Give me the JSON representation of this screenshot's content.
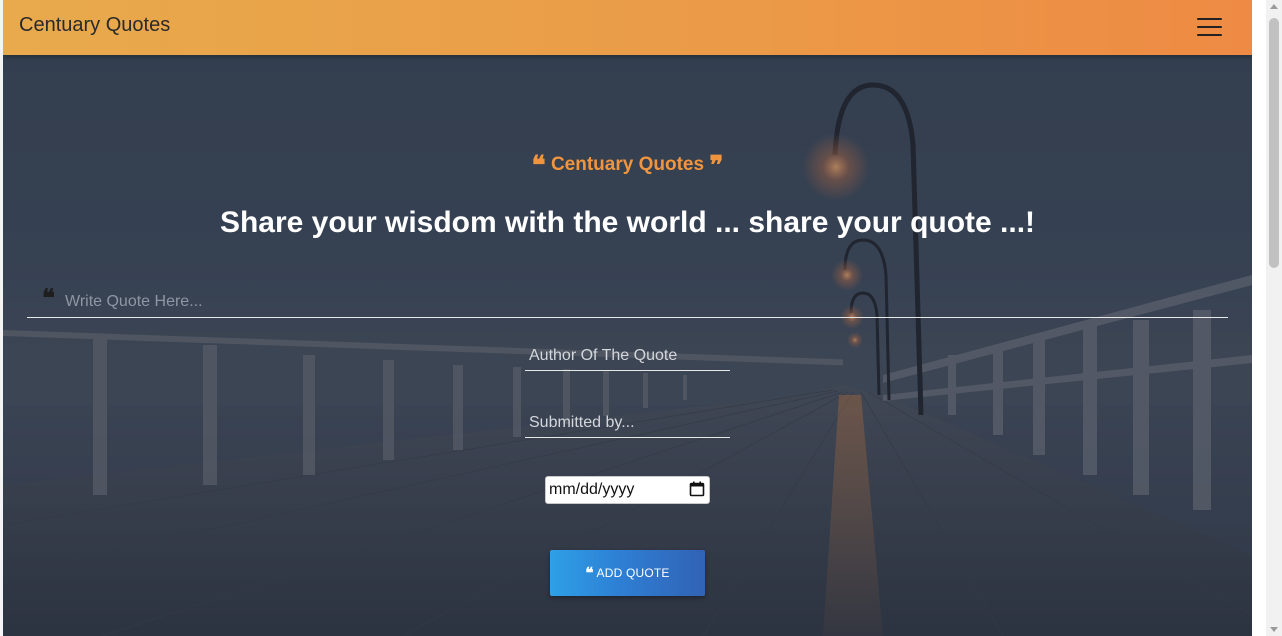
{
  "navbar": {
    "brand": "Centuary Quotes",
    "menu_icon": "hamburger-menu-icon"
  },
  "hero": {
    "small_title": "Centuary Quotes",
    "open_quote_glyph": "❝",
    "close_quote_glyph": "❞",
    "headline": "Share your wisdom with the world ... share your quote ...!"
  },
  "form": {
    "quote_icon": "quote-left-icon",
    "quote_placeholder": "Write Quote Here...",
    "author_placeholder": "Author Of The Quote",
    "submitted_placeholder": "Submitted by...",
    "date_placeholder": "mm/dd/yyyy",
    "calendar_icon": "calendar-icon",
    "button_label": "ADD QUOTE",
    "button_icon": "quote-left-icon"
  },
  "colors": {
    "navbar_start": "#e8aa4c",
    "navbar_end": "#ee8a44",
    "accent_orange": "#f0953d",
    "button_start": "#2ea0e6",
    "button_end": "#3162b5",
    "hero_bg": "#3f4b5e"
  }
}
